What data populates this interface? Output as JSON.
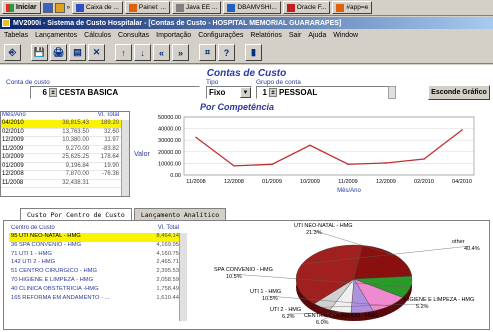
{
  "taskbar": {
    "start_label": "Iniciar",
    "tasks": [
      {
        "label": "Caixa de ...",
        "color": "#3050c0"
      },
      {
        "label": "Painel: ...",
        "color": "#e06010"
      },
      {
        "label": "Java EE ...",
        "color": "#808080"
      },
      {
        "label": "DBAMVSHI...",
        "color": "#2060c0"
      },
      {
        "label": "Oracle F...",
        "color": "#c02020"
      },
      {
        "label": "#app=e",
        "color": "#e06010"
      }
    ]
  },
  "window": {
    "title": "MV2000i - Sistema de Custo Hospitalar - [Contas de Custo - HOSPITAL MEMORIAL GUARARAPES]"
  },
  "menu": [
    {
      "label": "Tabelas"
    },
    {
      "label": "Lançamentos"
    },
    {
      "label": "Cálculos"
    },
    {
      "label": "Consultas"
    },
    {
      "label": "Importação"
    },
    {
      "label": "Configurações"
    },
    {
      "label": "Relatórios"
    },
    {
      "label": "Sair"
    },
    {
      "label": "Ajuda"
    },
    {
      "label": "Window"
    }
  ],
  "toolbar": {
    "buttons": [
      "exit-icon",
      "save-icon",
      "print-icon",
      "print-preview-icon",
      "delete-icon",
      "up-arrow-icon",
      "down-arrow-icon",
      "first-record-icon",
      "last-record-icon",
      "chart-icon",
      "help-icon",
      "exit-door-icon"
    ],
    "glyphs": [
      "⎆",
      "💾",
      "🖨",
      "▤",
      "✕",
      "↑",
      "↓",
      "«",
      "»",
      "⌗",
      "?",
      "▮"
    ]
  },
  "form": {
    "title": "Contas de Custo",
    "conta_label": "Conta de custo",
    "conta_number": "6",
    "conta_name": "CESTA BASICA",
    "tipo_label": "Tipo",
    "tipo_value": "Fixo",
    "grupo_label": "Grupo de conta",
    "grupo_number": "1",
    "grupo_name": "PESSOAL",
    "esconde_button": "Esconde Gráfico"
  },
  "month_table": {
    "col_month": "Mês/Ano",
    "col_value": "Vl. Total",
    "rows": [
      {
        "month": "04/2010",
        "value": "38,815.43"
      },
      {
        "month": "02/2010",
        "value": "13,763.50"
      },
      {
        "month": "12/2009",
        "value": "10,380.00"
      },
      {
        "month": "11/2009",
        "value": "9,270.00"
      },
      {
        "month": "10/2009",
        "value": "25,625.25"
      },
      {
        "month": "01/2009",
        "value": "9,196.84"
      },
      {
        "month": "12/2008",
        "value": "7,870.00"
      },
      {
        "month": "11/2008",
        "value": "32,438.31"
      }
    ],
    "extra_col": [
      "189.20",
      "32.60",
      "11.97",
      "-83.82",
      "178.64",
      "19.90",
      "-76.36",
      ""
    ]
  },
  "chart_title": "Por Competência",
  "chart_data": {
    "type": "line",
    "x": [
      "11/2008",
      "12/2008",
      "01/2009",
      "10/2009",
      "11/2009",
      "12/2009",
      "02/2010",
      "04/2010"
    ],
    "values": [
      32438.31,
      7870.0,
      9196.84,
      25625.25,
      9270.0,
      10380.0,
      13763.5,
      38815.43
    ],
    "xlabel": "Mês/Ano",
    "ylabel": "Valor",
    "ylim": [
      0,
      50000
    ],
    "yticks": [
      "0.00",
      "10000.00",
      "20000.00",
      "30000.00",
      "40000.00",
      "50000.00"
    ],
    "line_color": "#c03030",
    "grid": true
  },
  "tabs": [
    {
      "label": "Custo Por Centro de Custo",
      "active": true
    },
    {
      "label": "Lançamento Analítico",
      "active": false
    }
  ],
  "cc_table": {
    "col_center": "Centro de Custo",
    "col_value": "Vl. Total",
    "rows": [
      {
        "center": "95 UTI NEO-NATAL - HMG",
        "value": "8,464.14"
      },
      {
        "center": "36 SPA CONVENIO - HMG",
        "value": "4,169.95"
      },
      {
        "center": "71 UTI 1 - HMG",
        "value": "4,160.75"
      },
      {
        "center": "142 UTI 2 - HMG",
        "value": "2,465.71"
      },
      {
        "center": "51 CENTRO CIRURGICO - HMG",
        "value": "2,395.53"
      },
      {
        "center": "70 HIGIENE E LIMPEZA - HMG",
        "value": "2,058.59"
      },
      {
        "center": "40 CLINICA OBSTETRICIA -HMG",
        "value": "1,758.49"
      },
      {
        "center": "165 REFORMA EM ANDAMENTO - ...",
        "value": "1,610.44"
      }
    ]
  },
  "pie_data": {
    "type": "pie",
    "slices": [
      {
        "label": "UTI NEO-NATAL - HMG",
        "pct_label": "21.3%",
        "value": 21.3,
        "color": "#8a1010"
      },
      {
        "label": "SPA CONVENIO - HMG",
        "pct_label": "10.5%",
        "value": 10.5,
        "color": "#2a9a2a"
      },
      {
        "label": "UTI 1 - HMG",
        "pct_label": "10.5%",
        "value": 10.5,
        "color": "#f08ad0"
      },
      {
        "label": "UTI 2 - HMG",
        "pct_label": "6.2%",
        "value": 6.2,
        "color": "#b090e0"
      },
      {
        "label": "CENTRO CIRURGICO - HMG",
        "pct_label": "6.0%",
        "value": 6.0,
        "color": "#f0f0f0"
      },
      {
        "label": "HIGIENE E LIMPEZA - HMG",
        "pct_label": "5.2%",
        "value": 5.2,
        "color": "#d0d0d0"
      },
      {
        "label": "other",
        "pct_label": "40.4%",
        "value": 40.4,
        "color": "#a02020"
      }
    ]
  }
}
